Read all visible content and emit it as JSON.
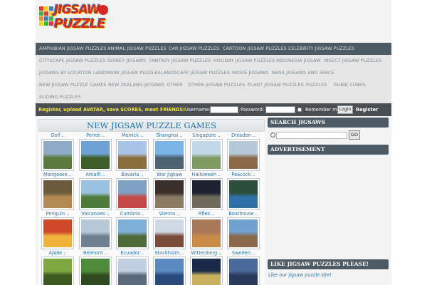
{
  "logo": {
    "line1": "JIGSAW",
    "line2": "PUZZLE"
  },
  "nav": [
    [
      "AMPHIBIAN JIGSAW PUZZLES",
      "ANIMAL JIGSAW PUZZLES",
      "CAR JIGSAW PUZZLES",
      "CARTOON JIGSAW PUZZLES",
      "CELEBRITY JIGSAW PUZZLES"
    ],
    [
      "CITYSCAPE JIGSAW PUZZLES",
      "DISNEY JIGSAWS",
      "FANTASY JIGSAW PUZZLES",
      "HOLIDAY JIGSAW PUZZLES",
      "INDONESIA JIGSAW",
      "INSECT JIGSAW PUZZLES"
    ],
    [
      "JIGSAWS BY LOCATION",
      "LANDMARK JIGSAW PUZZLES",
      "LANDSCAPE JIGSAW PUZZLES",
      "MOVIE JIGSAWS",
      "NASA JIGSAWS AND SPACE"
    ],
    [
      "NEW JIGSAW PUZZLE GAMES",
      "NEW ZEALAND JIGSAWS",
      "OTHER",
      "OTHER JIGSAW PUZZLES",
      "PLANT JIGSAW PUZZLES",
      "PUZZLES",
      "RUBIK CUBES"
    ],
    [
      "SLIDING PUZZLES"
    ]
  ],
  "login": {
    "promo": "Register, upload AVATAR, save SCORES, meet FRIENDS!",
    "username_label": "Username:",
    "password_label": "Password:",
    "remember_label": "Remember me",
    "login_button": "Login",
    "register_link": "Register"
  },
  "main": {
    "title": "NEW JIGSAW PUZZLE GAMES",
    "rows": [
      [
        "Golf ..",
        "Perrot ..",
        "Merrick ..",
        "Shanghai ..",
        "Singapore ..",
        "Dresden .."
      ],
      [
        "Mongoose ..",
        "Amalfi ..",
        "Bavaria ..",
        "War Jigsaw",
        "Halloween ..",
        "Peacock .."
      ],
      [
        "Penguin ..",
        "Volcanoes ..",
        "Cumbria ..",
        "Vienna ..",
        "Rfles ..",
        "Boathouse .."
      ],
      [
        "Apple ..",
        "Belmont ..",
        "Ecuador ..",
        "Stockholm ..",
        "Wittenberg ..",
        "Sweden .."
      ]
    ]
  },
  "sidebar": {
    "search_heading": "SEARCH JIGSAWS",
    "go_button": "GO",
    "ad_heading": "ADVERTISEMENT",
    "like_heading": "LIKE JIGSAW PUZZLES PLEASE!",
    "like_link": "Like our jigsaw puzzle site!"
  },
  "colors": {
    "nav_dark": "#4e5a63",
    "login_bar": "#4a4f54",
    "promo_yellow": "#f1e431",
    "link_blue": "#2a78b0",
    "title_blue": "#1c6fa8"
  },
  "icons": {
    "search": "magnifier-icon",
    "logo": "rubik-cube-icon"
  }
}
